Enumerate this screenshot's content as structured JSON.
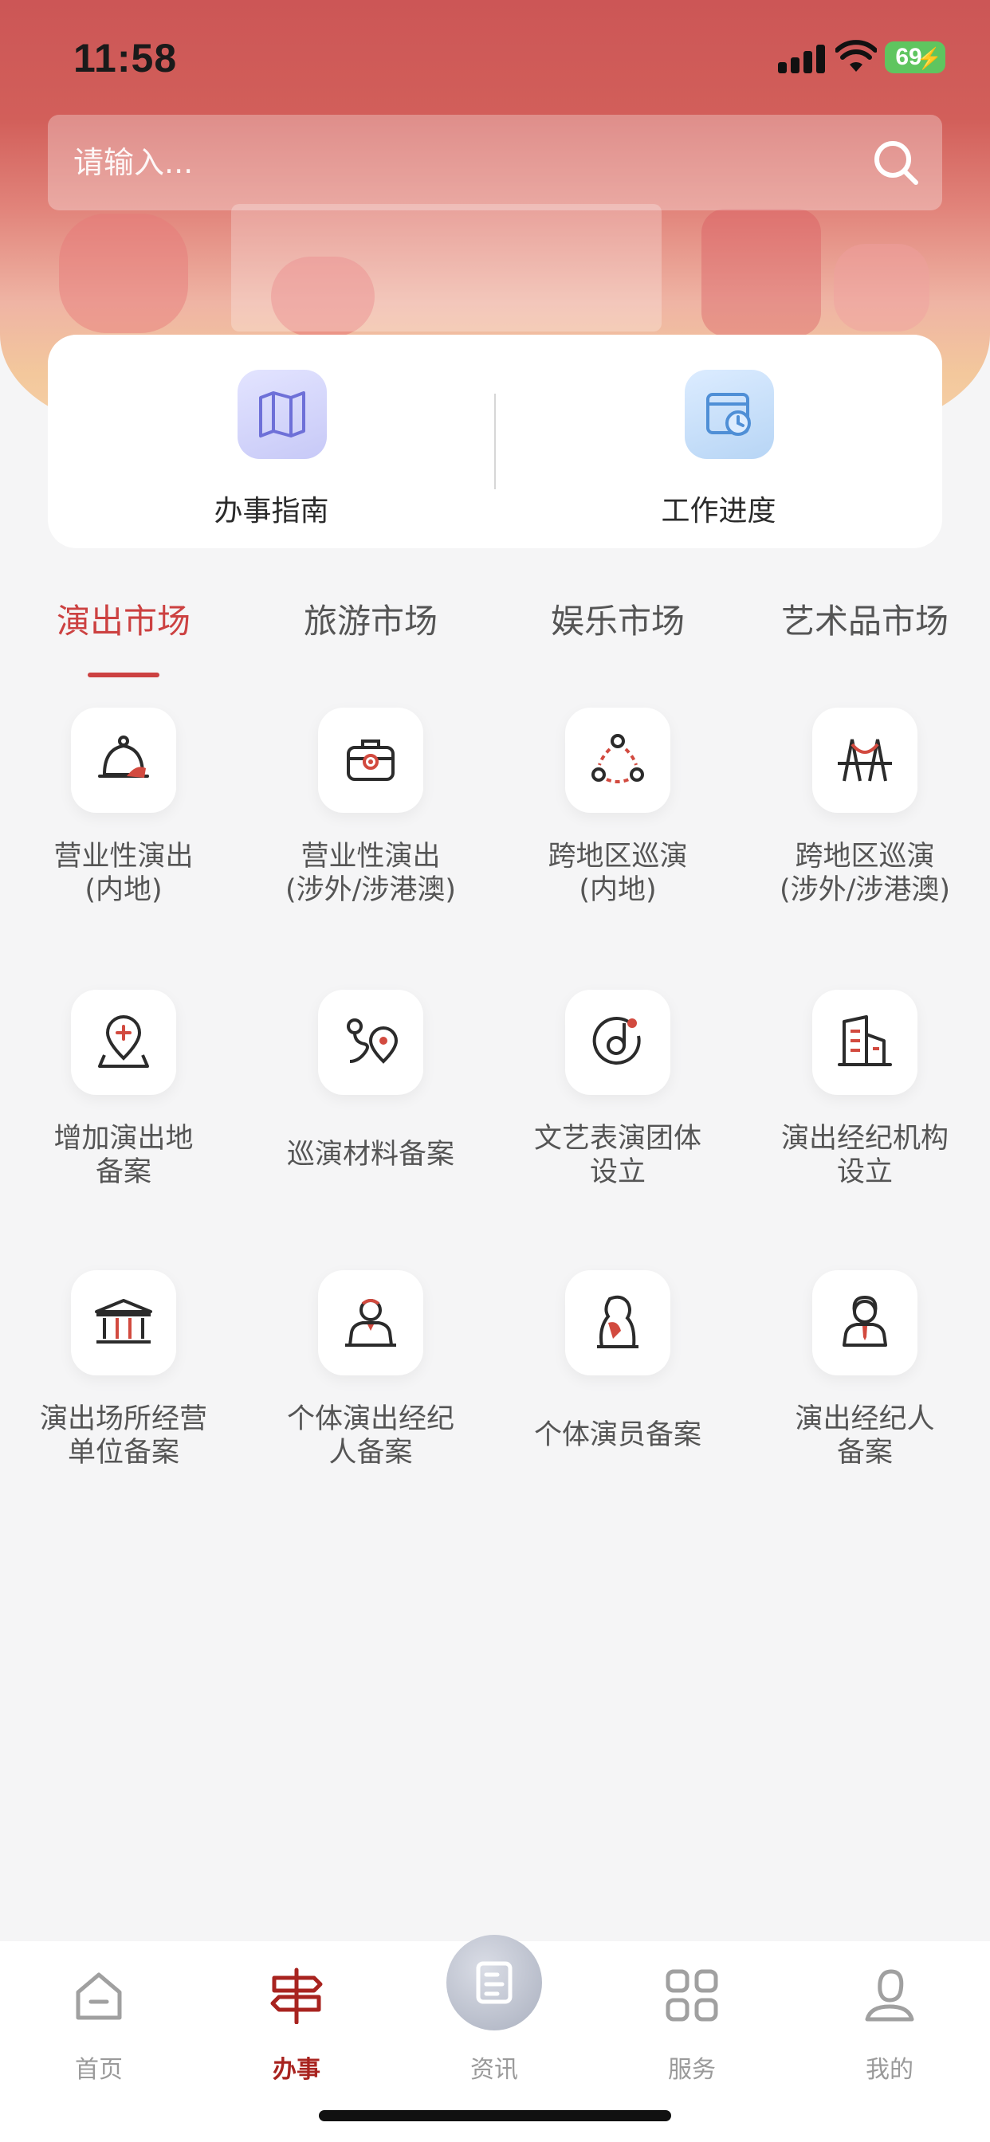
{
  "status_bar": {
    "time": "11:58",
    "battery": "69"
  },
  "search": {
    "placeholder": "请输入..."
  },
  "quick_actions": [
    {
      "label": "办事指南",
      "icon": "map-icon"
    },
    {
      "label": "工作进度",
      "icon": "calendar-clock-icon"
    }
  ],
  "tabs": [
    {
      "label": "演出市场",
      "active": true
    },
    {
      "label": "旅游市场",
      "active": false
    },
    {
      "label": "娱乐市场",
      "active": false
    },
    {
      "label": "艺术品市场",
      "active": false
    }
  ],
  "services": [
    {
      "label": "营业性演出\n(内地)",
      "icon": "bell-icon"
    },
    {
      "label": "营业性演出\n(涉外/涉港澳)",
      "icon": "briefcase-icon"
    },
    {
      "label": "跨地区巡演\n(内地)",
      "icon": "dots-cycle-icon"
    },
    {
      "label": "跨地区巡演\n(涉外/涉港澳)",
      "icon": "bridge-icon"
    },
    {
      "label": "增加演出地\n备案",
      "icon": "location-plus-icon"
    },
    {
      "label": "巡演材料备案",
      "icon": "route-icon"
    },
    {
      "label": "文艺表演团体\n设立",
      "icon": "music-disc-icon"
    },
    {
      "label": "演出经纪机构\n设立",
      "icon": "building-icon"
    },
    {
      "label": "演出场所经营\n单位备案",
      "icon": "venue-icon"
    },
    {
      "label": "个体演出经纪\n人备案",
      "icon": "agent-icon"
    },
    {
      "label": "个体演员备案",
      "icon": "performer-icon"
    },
    {
      "label": "演出经纪人\n备案",
      "icon": "broker-icon"
    }
  ],
  "bottom_nav": [
    {
      "label": "首页",
      "icon": "home-icon",
      "active": false
    },
    {
      "label": "办事",
      "icon": "signpost-icon",
      "active": true
    },
    {
      "label": "资讯",
      "icon": "news-icon",
      "active": false
    },
    {
      "label": "服务",
      "icon": "apps-grid-icon",
      "active": false
    },
    {
      "label": "我的",
      "icon": "profile-icon",
      "active": false
    }
  ],
  "colors": {
    "accent": "#cc4141",
    "header": "#cc5656",
    "active_nav": "#a8231f"
  }
}
